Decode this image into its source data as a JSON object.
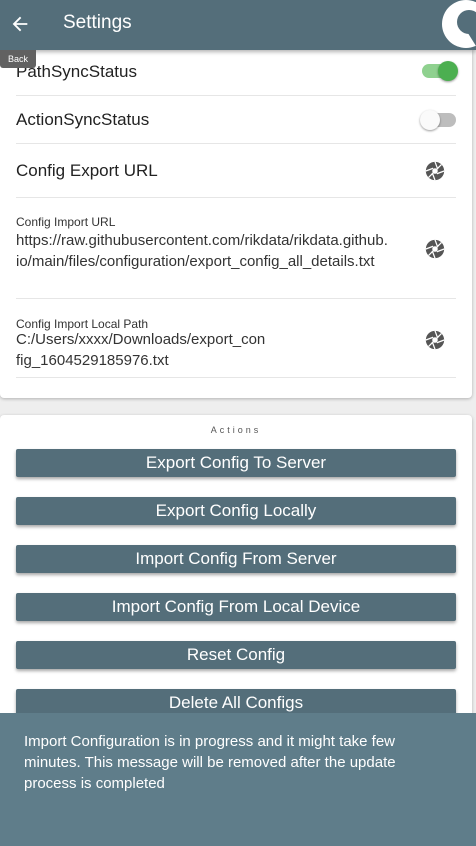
{
  "appbar": {
    "title": "Settings",
    "back_tooltip": "Back"
  },
  "settings": {
    "path_sync_label": "PathSyncStatus",
    "path_sync_on": true,
    "action_sync_label": "ActionSyncStatus",
    "action_sync_on": false,
    "export_url_label": "Config Export URL",
    "import_url_label": "Config Import URL",
    "import_url_value": "https://raw.githubusercontent.com/rikdata/rikdata.github.io/main/files/configuration/export_config_all_details.txt",
    "import_path_label": "Config Import Local Path",
    "import_path_value": "C:/Users/xxxx/Downloads/export_config_1604529185976.txt"
  },
  "actions": {
    "title": "Actions",
    "buttons": [
      "Export Config To Server",
      "Export Config Locally",
      "Import Config From Server",
      "Import Config From Local Device",
      "Reset Config",
      "Delete All Configs"
    ]
  },
  "snackbar": {
    "message": "Import Configuration is in progress and it might take few minutes. This message will be removed after the update process is completed"
  },
  "colors": {
    "appbar": "#546e7a",
    "toggle_on": "#4caf50",
    "button": "#546e7a",
    "snackbar": "#5f7d8a"
  }
}
